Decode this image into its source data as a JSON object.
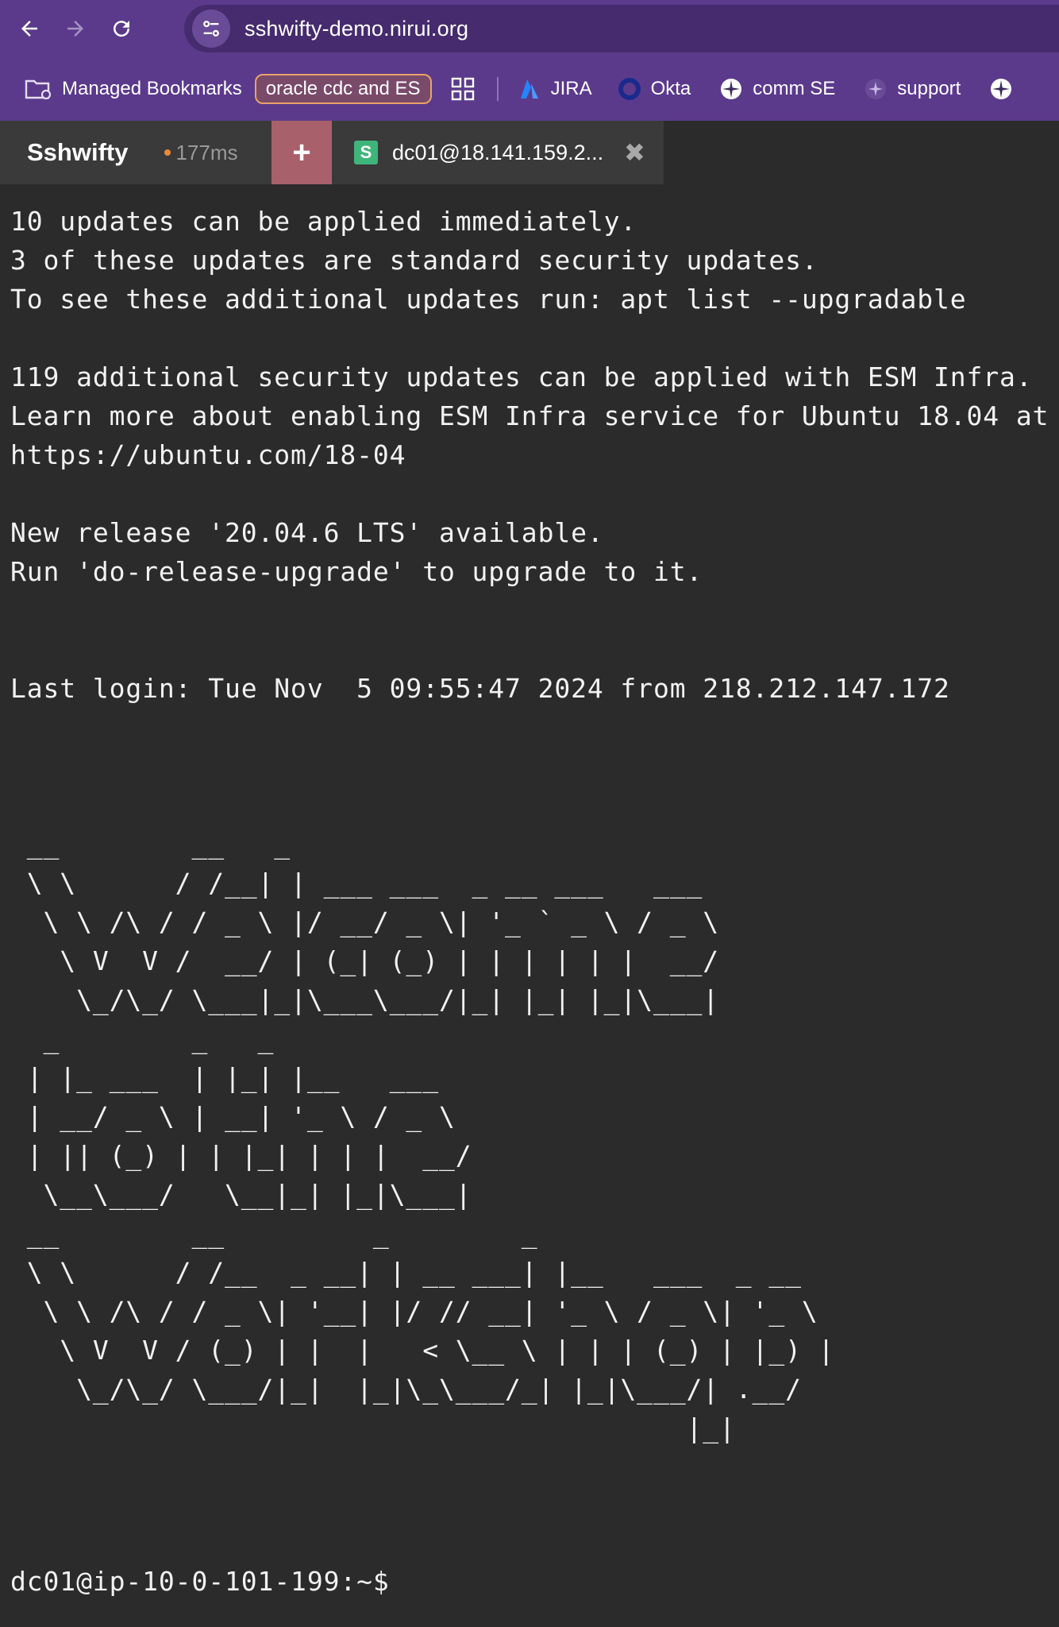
{
  "browser": {
    "url": "sshwifty-demo.nirui.org",
    "bookmarks": [
      {
        "label": "Managed Bookmarks",
        "icon": "folder-managed-icon"
      },
      {
        "label": "oracle cdc and ES",
        "icon": ""
      },
      {
        "label": "",
        "icon": "apps-grid-icon"
      },
      {
        "label": "JIRA",
        "icon": "jira-icon"
      },
      {
        "label": "Okta",
        "icon": "okta-icon"
      },
      {
        "label": "comm SE",
        "icon": "compass-icon"
      },
      {
        "label": "support",
        "icon": "compass-icon"
      }
    ]
  },
  "app": {
    "brand": "Sshwifty",
    "latency": "177ms",
    "add_tab_symbol": "+",
    "tab": {
      "icon_letter": "S",
      "title": "dc01@18.141.159.2...",
      "close_symbol": "✖"
    }
  },
  "terminal": {
    "output": "10 updates can be applied immediately.\n3 of these updates are standard security updates.\nTo see these additional updates run: apt list --upgradable\n\n119 additional security updates can be applied with ESM Infra.\nLearn more about enabling ESM Infra service for Ubuntu 18.04 at\nhttps://ubuntu.com/18-04\n\nNew release '20.04.6 LTS' available.\nRun 'do-release-upgrade' to upgrade to it.\n\n\nLast login: Tue Nov  5 09:55:47 2024 from 218.212.147.172\n\n\n\n __        __   _\n \\ \\      / /__| | ___ ___  _ __ ___   ___\n  \\ \\ /\\ / / _ \\ |/ __/ _ \\| '_ ` _ \\ / _ \\\n   \\ V  V /  __/ | (_| (_) | | | | | |  __/\n    \\_/\\_/ \\___|_|\\___\\___/|_| |_| |_|\\___|\n  _        _   _\n | |_ ___  | |_| |__   ___\n | __/ _ \\ | __| '_ \\ / _ \\\n | || (_) | | |_| | | |  __/\n  \\__\\___/   \\__|_| |_|\\___|\n __        __         _        _\n \\ \\      / /__  _ __| | __ ___| |__   ___  _ __\n  \\ \\ /\\ / / _ \\| '__| |/ // __| '_ \\ / _ \\| '_ \\\n   \\ V  V / (_) | |  |   < \\__ \\ | | | (_) | |_) |\n    \\_/\\_/ \\___/|_|  |_|\\_\\___/_| |_|\\___/| .__/\n                                         |_|",
    "prompt": "dc01@ip-10-0-101-199:~$"
  },
  "colors": {
    "browser_chrome": "#5b3a8c",
    "terminal_bg": "#2b2b2b",
    "add_tab": "#a8616b",
    "tab_icon": "#3fb57c",
    "latency_dot": "#e8893a"
  }
}
